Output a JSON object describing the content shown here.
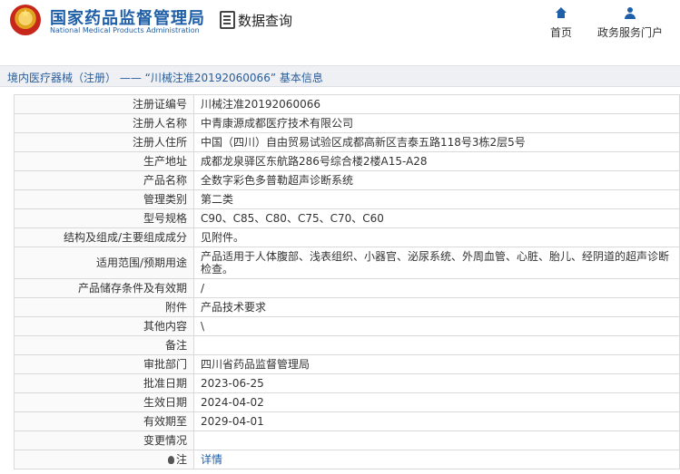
{
  "header": {
    "org_name": "国家药品监督管理局",
    "org_name_en": "National Medical Products Administration",
    "query_label": "数据查询",
    "nav": [
      {
        "icon": "home-icon",
        "label": "首页"
      },
      {
        "icon": "user-icon",
        "label": "政务服务门户"
      }
    ]
  },
  "breadcrumb": "境内医疗器械（注册） —— “川械注准20192060066” 基本信息",
  "rows": [
    {
      "label": "注册证编号",
      "value": "川械注准20192060066"
    },
    {
      "label": "注册人名称",
      "value": "中青康源成都医疗技术有限公司"
    },
    {
      "label": "注册人住所",
      "value": "中国（四川）自由贸易试验区成都高新区吉泰五路118号3栋2层5号"
    },
    {
      "label": "生产地址",
      "value": "成都龙泉驿区东航路286号综合楼2楼A15-A28"
    },
    {
      "label": "产品名称",
      "value": "全数字彩色多普勒超声诊断系统"
    },
    {
      "label": "管理类别",
      "value": "第二类"
    },
    {
      "label": "型号规格",
      "value": "C90、C85、C80、C75、C70、C60"
    },
    {
      "label": "结构及组成/主要组成成分",
      "value": "见附件。"
    },
    {
      "label": "适用范围/预期用途",
      "value": "产品适用于人体腹部、浅表组织、小器官、泌尿系统、外周血管、心脏、胎儿、经阴道的超声诊断检查。"
    },
    {
      "label": "产品储存条件及有效期",
      "value": "/"
    },
    {
      "label": "附件",
      "value": "产品技术要求"
    },
    {
      "label": "其他内容",
      "value": "\\"
    },
    {
      "label": "备注",
      "value": ""
    },
    {
      "label": "审批部门",
      "value": "四川省药品监督管理局"
    },
    {
      "label": "批准日期",
      "value": "2023-06-25"
    },
    {
      "label": "生效日期",
      "value": "2024-04-02"
    },
    {
      "label": "有效期至",
      "value": "2029-04-01"
    },
    {
      "label": "变更情况",
      "value": ""
    },
    {
      "label": "注",
      "value": "详情"
    }
  ]
}
